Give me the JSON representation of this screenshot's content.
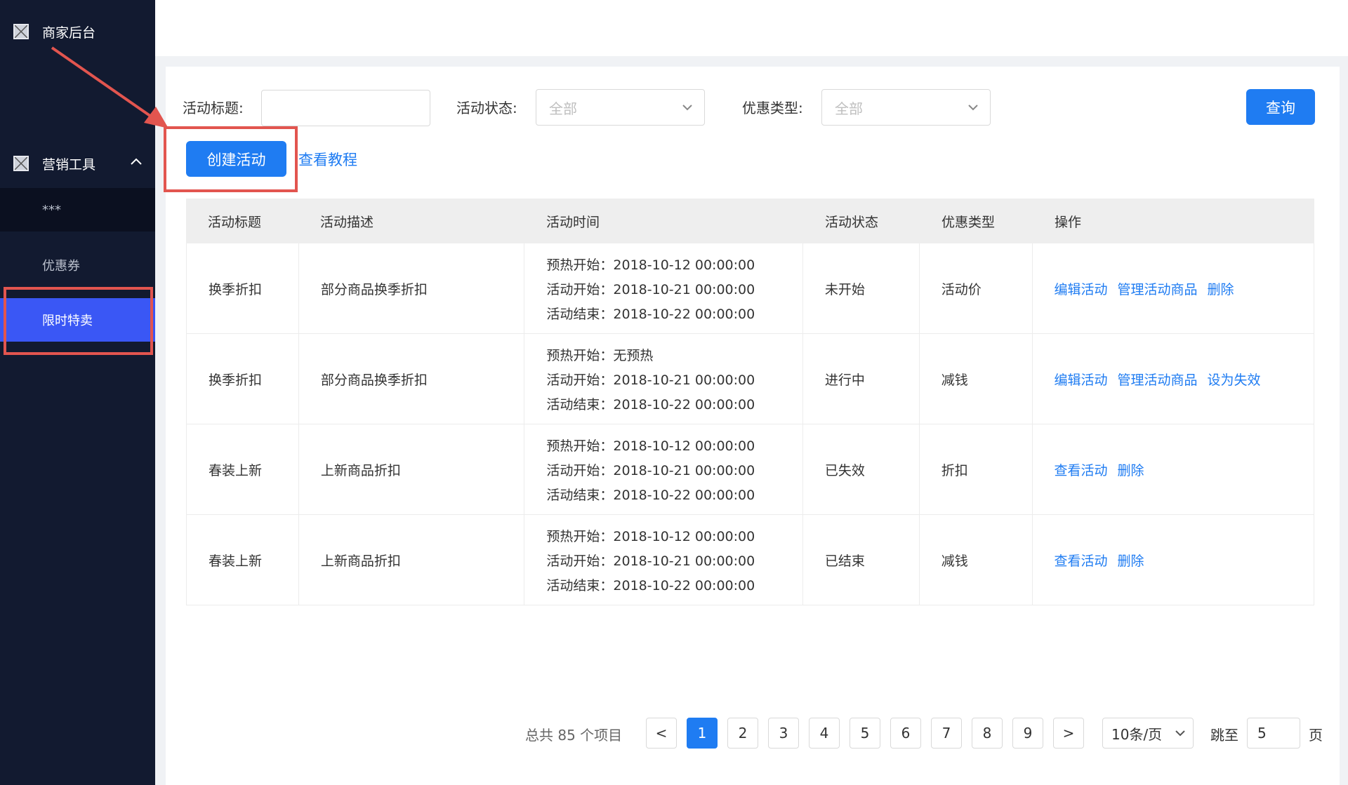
{
  "sidebar": {
    "brand": "商家后台",
    "group": "营销工具",
    "items": [
      {
        "label": "***"
      },
      {
        "label": "优惠券"
      },
      {
        "label": "限时特卖"
      }
    ]
  },
  "filters": {
    "title_label": "活动标题:",
    "title_value": "",
    "status_label": "活动状态:",
    "status_value": "全部",
    "type_label": "优惠类型:",
    "type_value": "全部",
    "query_button": "查询"
  },
  "actions": {
    "create": "创建活动",
    "tutorial": "查看教程"
  },
  "table": {
    "headers": [
      "活动标题",
      "活动描述",
      "活动时间",
      "活动状态",
      "优惠类型",
      "操作"
    ],
    "rows": [
      {
        "title": "换季折扣",
        "desc": "部分商品换季折扣",
        "time": [
          "预热开始：2018-10-12 00:00:00",
          "活动开始：2018-10-21 00:00:00",
          "活动结束：2018-10-22 00:00:00"
        ],
        "status": "未开始",
        "type": "活动价",
        "ops": [
          "编辑活动",
          "管理活动商品",
          "删除"
        ]
      },
      {
        "title": "换季折扣",
        "desc": "部分商品换季折扣",
        "time": [
          "预热开始：无预热",
          "活动开始：2018-10-21 00:00:00",
          "活动结束：2018-10-22 00:00:00"
        ],
        "status": "进行中",
        "type": "减钱",
        "ops": [
          "编辑活动",
          "管理活动商品",
          "设为失效"
        ]
      },
      {
        "title": "春装上新",
        "desc": "上新商品折扣",
        "time": [
          "预热开始：2018-10-12 00:00:00",
          "活动开始：2018-10-21 00:00:00",
          "活动结束：2018-10-22 00:00:00"
        ],
        "status": "已失效",
        "type": "折扣",
        "ops": [
          "查看活动",
          "删除"
        ]
      },
      {
        "title": "春装上新",
        "desc": "上新商品折扣",
        "time": [
          "预热开始：2018-10-12 00:00:00",
          "活动开始：2018-10-21 00:00:00",
          "活动结束：2018-10-22 00:00:00"
        ],
        "status": "已结束",
        "type": "减钱",
        "ops": [
          "查看活动",
          "删除"
        ]
      }
    ]
  },
  "pagination": {
    "total": "总共 85 个项目",
    "prev": "<",
    "next": ">",
    "pages": [
      "1",
      "2",
      "3",
      "4",
      "5",
      "6",
      "7",
      "8",
      "9"
    ],
    "current": "1",
    "page_size": "10条/页",
    "jump_label": "跳至",
    "jump_value": "5",
    "page_suffix": "页"
  },
  "colors": {
    "sidebar_bg": "#121a30",
    "active_item": "#3a57f5",
    "primary": "#1f7cf2",
    "annotation": "#e2554f"
  }
}
